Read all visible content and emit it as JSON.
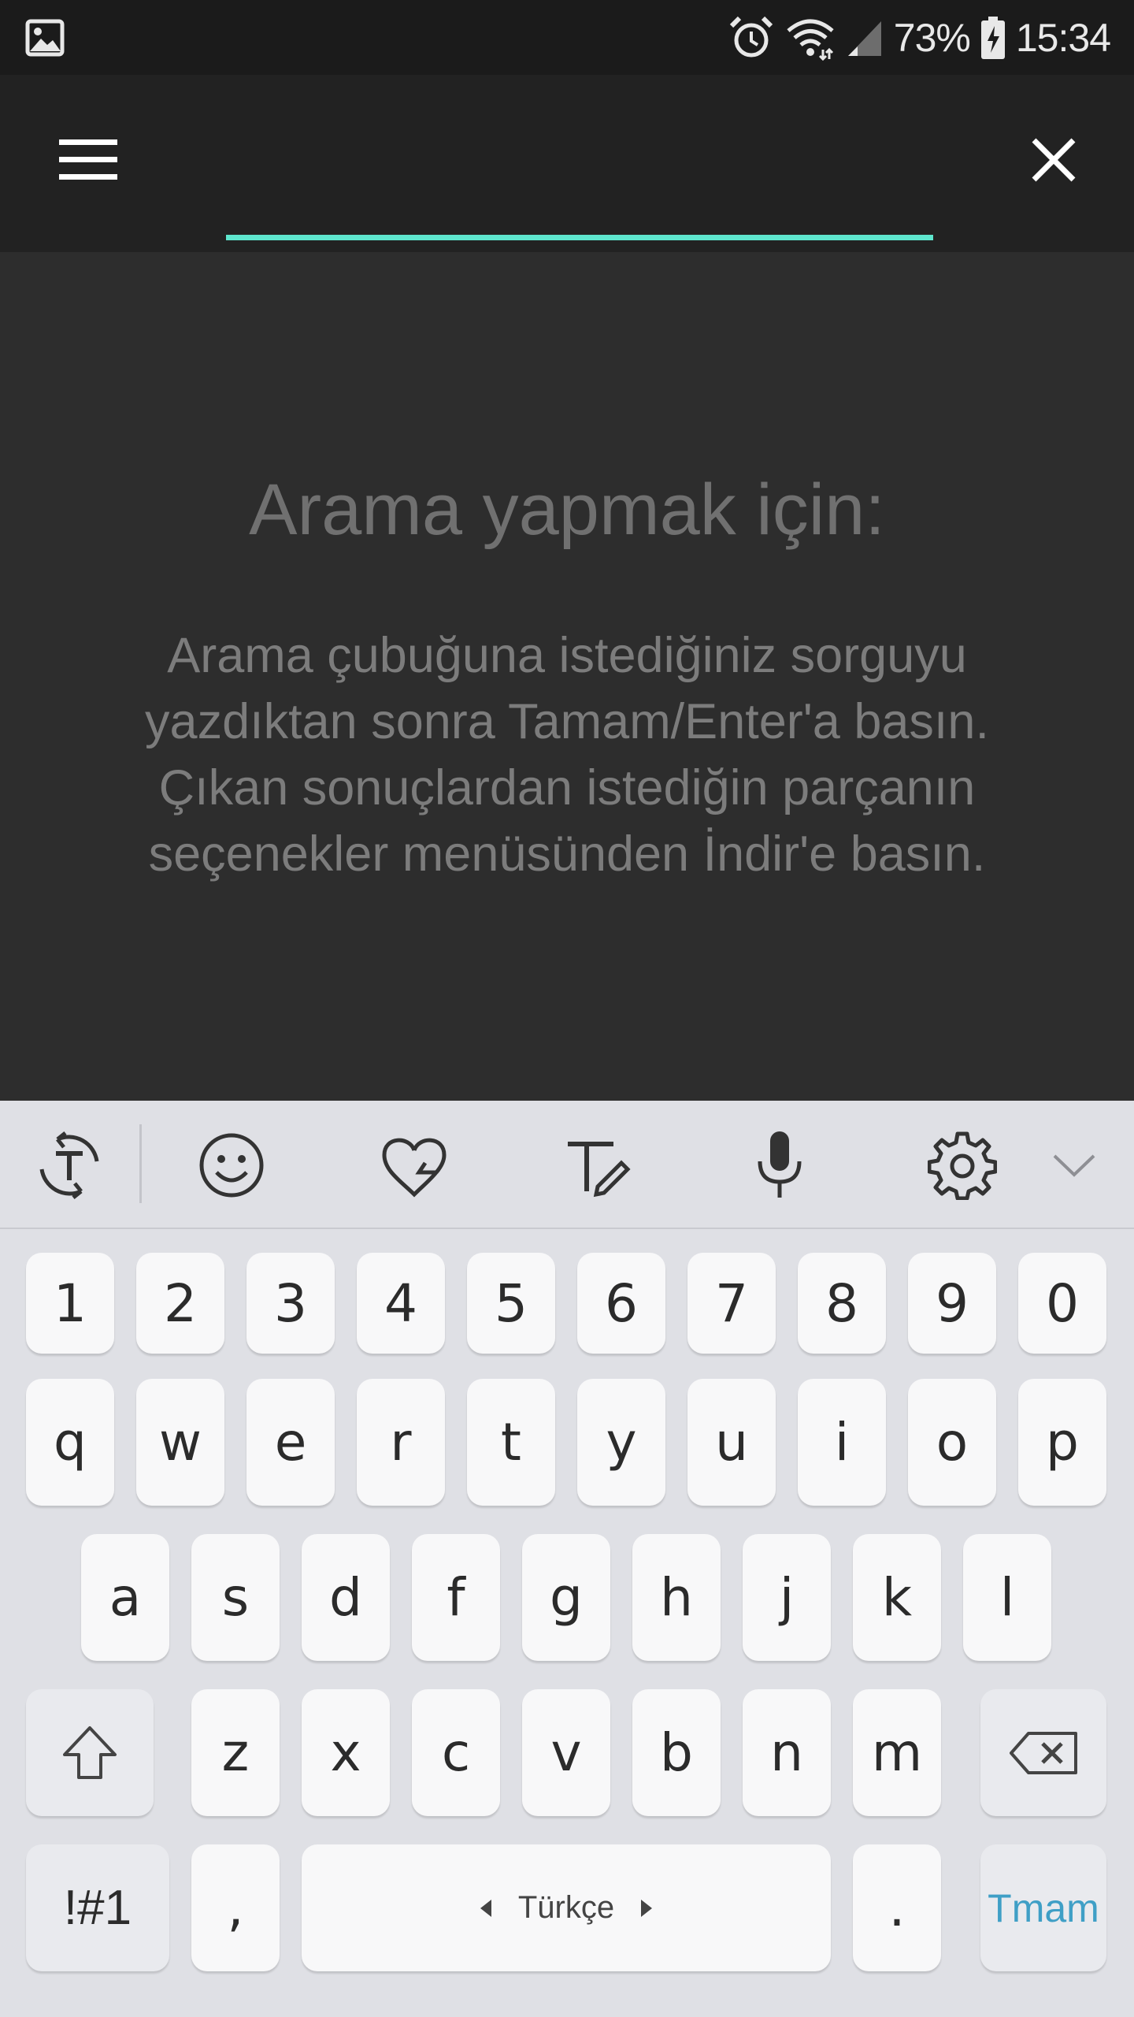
{
  "status_bar": {
    "icons": [
      "gallery-icon",
      "alarm-icon",
      "wifi-icon",
      "signal-icon",
      "battery-charging-icon"
    ],
    "battery": "73%",
    "time": "15:34"
  },
  "app_bar": {
    "icons": [
      "menu-icon",
      "close-icon"
    ],
    "search_value": "",
    "accent_color": "#5ee6cd"
  },
  "help": {
    "title": "Arama yapmak için:",
    "body": "Arama çubuğuna istediğiniz sorguyu\nyazdıktan sonra Tamam/Enter'a basın.\nÇıkan sonuçlardan istediğin parçanın\nseçenekler menüsünden İndir'e basın."
  },
  "keyboard": {
    "toolbar_icons": [
      "translate-icon",
      "emoji-icon",
      "sticker-heart-icon",
      "handwriting-icon",
      "microphone-icon",
      "settings-icon",
      "chevron-down-icon"
    ],
    "rows": {
      "numbers": [
        "1",
        "2",
        "3",
        "4",
        "5",
        "6",
        "7",
        "8",
        "9",
        "0"
      ],
      "row1": [
        "q",
        "w",
        "e",
        "r",
        "t",
        "y",
        "u",
        "i",
        "o",
        "p"
      ],
      "row2": [
        "a",
        "s",
        "d",
        "f",
        "g",
        "h",
        "j",
        "k",
        "l"
      ],
      "row3": [
        "z",
        "x",
        "c",
        "v",
        "b",
        "n",
        "m"
      ]
    },
    "symbols_label": "!#1",
    "comma": ",",
    "space_label": "Türkçe",
    "period": ".",
    "done_label": "Tmam",
    "done_color": "#3f9fc6"
  }
}
